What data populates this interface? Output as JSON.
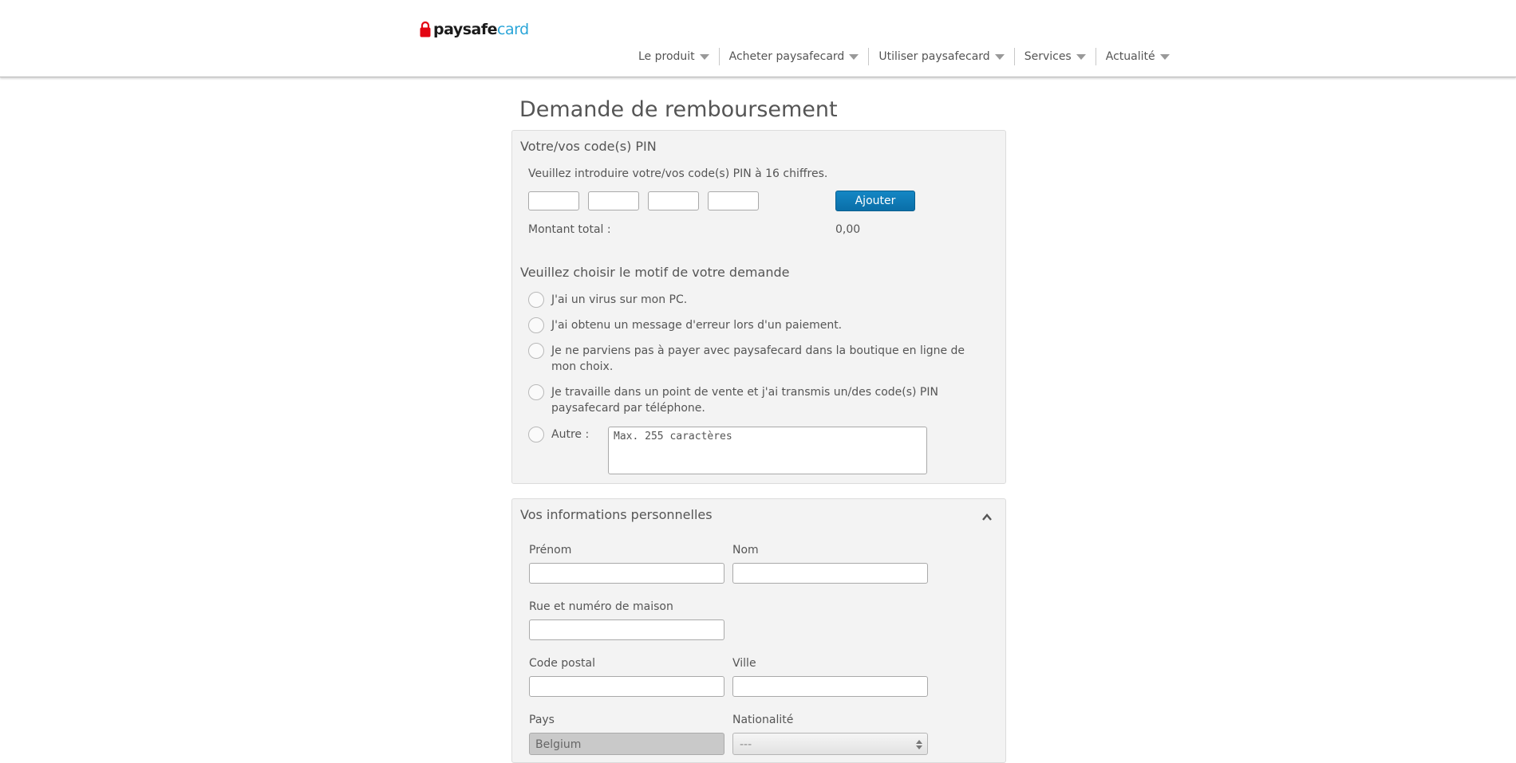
{
  "brand": {
    "name_part1": "paysafe",
    "name_part2": "card"
  },
  "nav": [
    {
      "label": "Le produit"
    },
    {
      "label": "Acheter paysafecard"
    },
    {
      "label": "Utiliser paysafecard"
    },
    {
      "label": "Services"
    },
    {
      "label": "Actualité"
    }
  ],
  "page_title": "Demande de remboursement",
  "pin_section": {
    "title": "Votre/vos code(s) PIN",
    "instruction": "Veuillez introduire votre/vos code(s) PIN à 16 chiffres.",
    "add_button": "Ajouter",
    "total_label": "Montant total :",
    "total_value": "0,00"
  },
  "reason_section": {
    "title": "Veuillez choisir le motif de votre demande",
    "options": [
      {
        "label": "J'ai un virus sur mon PC."
      },
      {
        "label": "J'ai obtenu un message d'erreur lors d'un paiement."
      },
      {
        "label": "Je ne parviens pas à payer avec paysafecard dans la boutique en ligne de mon choix."
      },
      {
        "label": "Je travaille dans un point de vente et j'ai transmis un/des code(s) PIN paysafecard par téléphone."
      },
      {
        "label": "Autre :"
      }
    ],
    "other_placeholder": "Max. 255 caractères"
  },
  "personal_section": {
    "title": "Vos informations personnelles",
    "first_name_label": "Prénom",
    "last_name_label": "Nom",
    "street_label": "Rue et numéro de maison",
    "postal_label": "Code postal",
    "city_label": "Ville",
    "country_label": "Pays",
    "country_value": "Belgium",
    "nationality_label": "Nationalité",
    "nationality_value": "---"
  },
  "colors": {
    "accent_button": "#0a6fa8",
    "brand_blue": "#2aa5d8",
    "lock_red": "#e30613"
  }
}
